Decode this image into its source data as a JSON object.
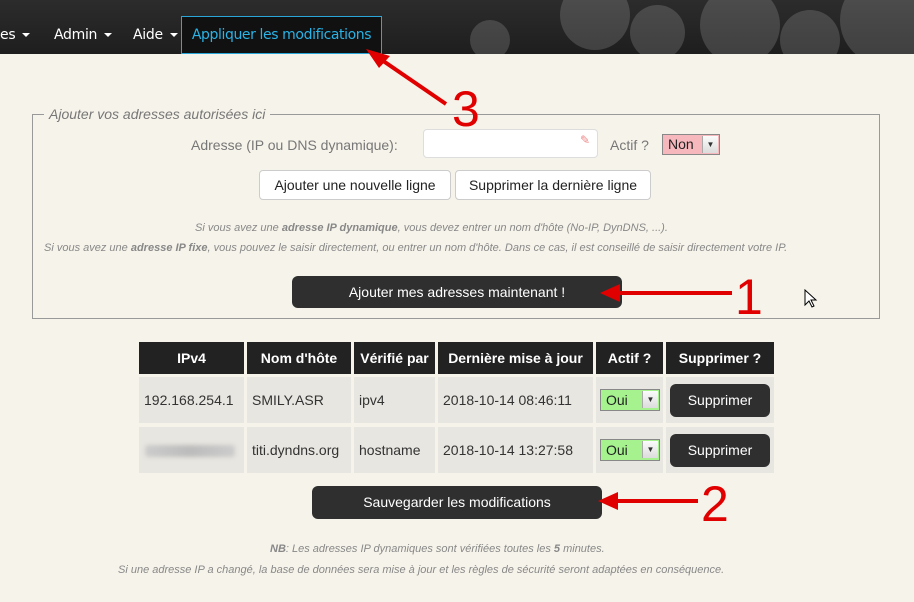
{
  "navbar": {
    "items": [
      {
        "label": "es"
      },
      {
        "label": "Admin"
      },
      {
        "label": "Aide"
      }
    ],
    "apply_label": "Appliquer les modifications"
  },
  "form": {
    "legend": "Ajouter vos adresses autorisées ici",
    "address_label": "Adresse (IP ou DNS dynamique):",
    "address_value": "",
    "actif_label": "Actif ?",
    "actif_value": "Non",
    "add_line_label": "Ajouter une nouvelle ligne",
    "remove_line_label": "Supprimer la dernière ligne",
    "note_line1_pre": "Si vous avez une ",
    "note_line1_bold": "adresse IP dynamique",
    "note_line1_post": ", vous devez entrer un nom d'hôte (No-IP, DynDNS, ...).",
    "note_line2_pre": "Si vous avez une ",
    "note_line2_bold": "adresse IP fixe",
    "note_line2_post": ", vous pouvez le saisir directement, ou entrer un nom d'hôte. Dans ce cas, il est conseillé de saisir directement votre IP.",
    "submit_label": "Ajouter mes adresses maintenant !"
  },
  "table": {
    "headers": [
      "IPv4",
      "Nom d'hôte",
      "Vérifié par",
      "Dernière mise à jour",
      "Actif ?",
      "Supprimer ?"
    ],
    "rows": [
      {
        "ipv4": "192.168.254.1",
        "hostname": "SMILY.ASR",
        "verified_by": "ipv4",
        "updated": "2018-10-14 08:46:11",
        "actif": "Oui",
        "delete_label": "Supprimer"
      },
      {
        "ipv4": "",
        "hostname": "titi.dyndns.org",
        "verified_by": "hostname",
        "updated": "2018-10-14 13:27:58",
        "actif": "Oui",
        "delete_label": "Supprimer"
      }
    ]
  },
  "save_label": "Sauvegarder les modifications",
  "footer": {
    "line1_bold": "NB",
    "line1_pre": ": Les adresses IP dynamiques sont vérifiées toutes les ",
    "line1_num": "5",
    "line1_post": " minutes.",
    "line2": "Si une adresse IP a changé, la base de données sera mise à jour et les règles de sécurité seront adaptées en conséquence."
  },
  "annotations": {
    "one": "1",
    "two": "2",
    "three": "3"
  },
  "colors": {
    "accent": "#2ab3e6",
    "annotation": "#e10000",
    "inactive": "#f7b8bd",
    "active": "#a5f28e"
  }
}
